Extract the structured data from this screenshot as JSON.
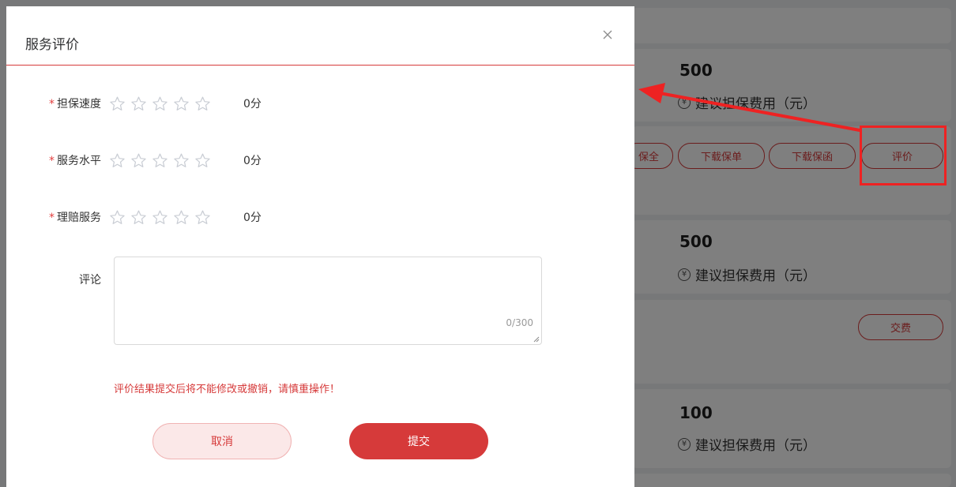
{
  "dialog": {
    "title": "服务评价",
    "ratings": [
      {
        "required_mark": "*",
        "label": "担保速度",
        "score": "0分"
      },
      {
        "required_mark": "*",
        "label": "服务水平",
        "score": "0分"
      },
      {
        "required_mark": "*",
        "label": "理赔服务",
        "score": "0分"
      }
    ],
    "comment_label": "评论",
    "comment_value": "",
    "comment_counter": "0/300",
    "warning": "评价结果提交后将不能修改或撤销，请慎重操作！",
    "cancel_label": "取消",
    "submit_label": "提交"
  },
  "background": {
    "cards": [
      {
        "amount": "500",
        "fee_label": "建议担保费用（元）"
      },
      {
        "amount": "500",
        "fee_label": "建议担保费用（元）"
      },
      {
        "amount": "100",
        "fee_label": "建议担保费用（元）"
      }
    ],
    "buttons": {
      "bao_quan": "保全",
      "download_policy": "下载保单",
      "download_letter": "下载保函",
      "evaluate": "评价",
      "pay_fee": "交费"
    },
    "currency_symbol": "¥"
  },
  "colors": {
    "accent": "#d63a3a",
    "annotation": "#ee2222",
    "star_outline": "#c9cdd4"
  }
}
